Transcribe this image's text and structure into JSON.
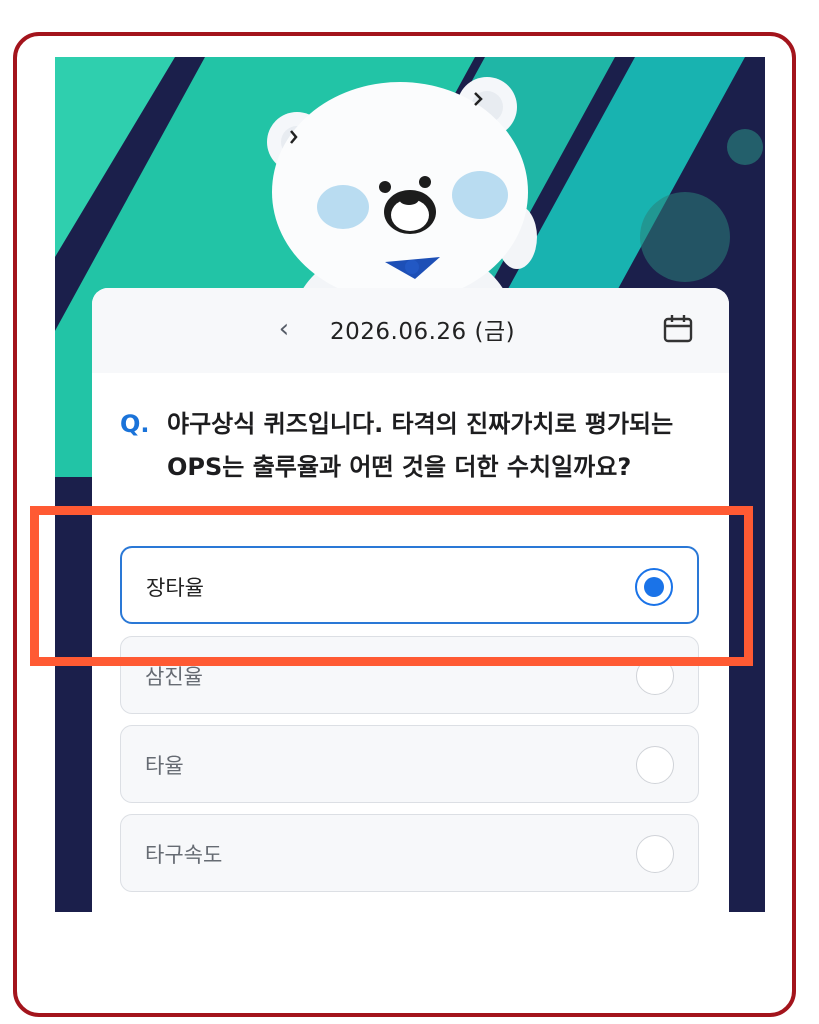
{
  "header": {
    "date": "2026.06.26 (금)",
    "back_icon": "chevron-left-icon",
    "calendar_icon": "calendar-icon"
  },
  "quiz": {
    "q_mark": "Q.",
    "question": "야구상식 퀴즈입니다. 타격의 진짜가치로 평가되는 OPS는 출루율과 어떤 것을 더한 수치일까요?",
    "options": [
      {
        "label": "장타율",
        "selected": true
      },
      {
        "label": "삼진율",
        "selected": false
      },
      {
        "label": "타율",
        "selected": false
      },
      {
        "label": "타구속도",
        "selected": false
      }
    ]
  },
  "colors": {
    "accent": "#1a73e8",
    "highlight": "#ff5a33",
    "frame": "#a3141c",
    "hero_teal": "#23c7a8",
    "hero_navy": "#1b1f4b"
  }
}
